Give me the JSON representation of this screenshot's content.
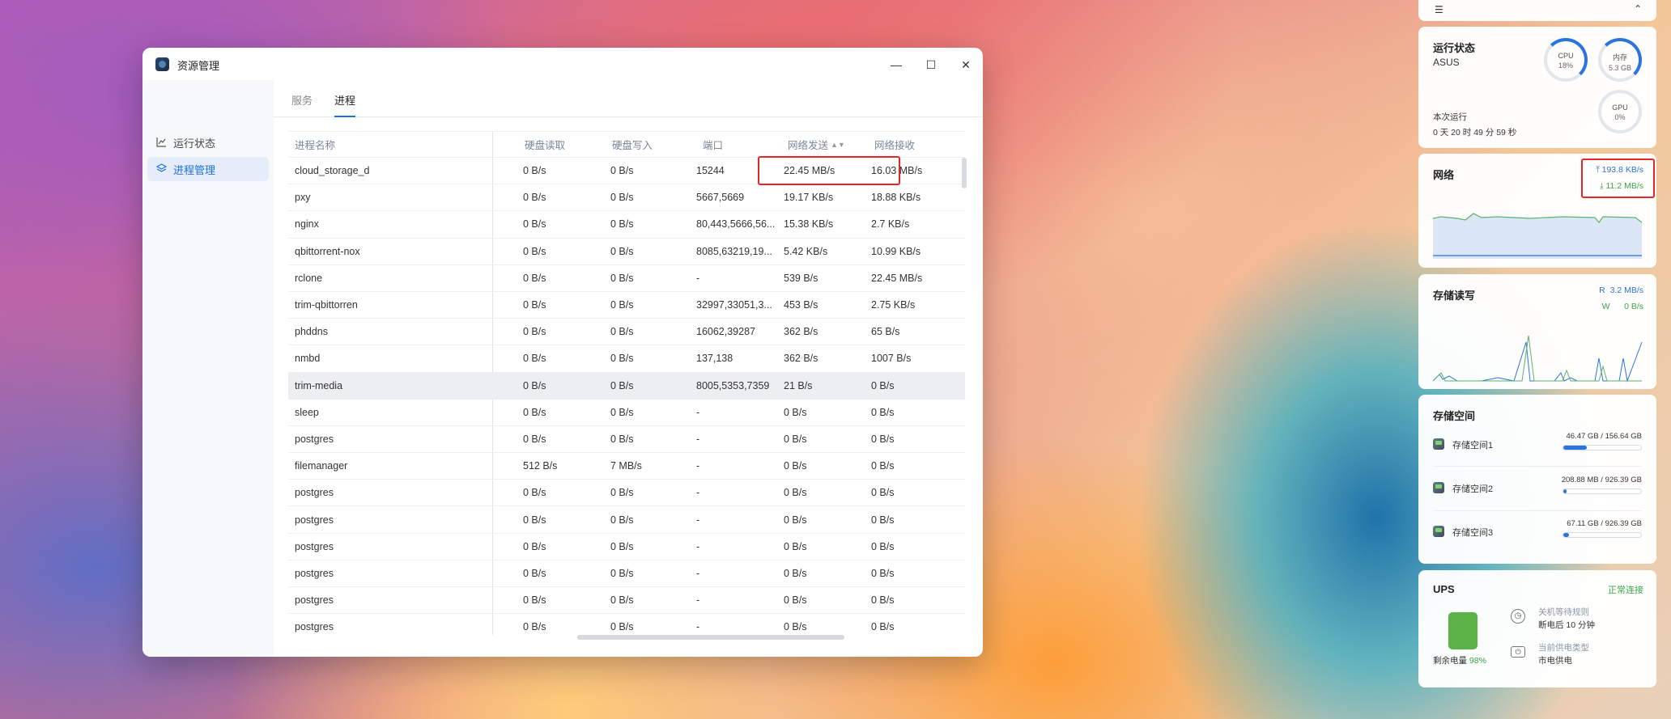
{
  "window": {
    "title": "资源管理",
    "controls": {
      "minimize": "—",
      "maximize": "☐",
      "close": "✕"
    }
  },
  "sidebar": {
    "items": [
      {
        "label": "运行状态",
        "icon": "line-chart-icon",
        "active": false
      },
      {
        "label": "进程管理",
        "icon": "layers-icon",
        "active": true
      }
    ]
  },
  "tabs": [
    {
      "label": "服务",
      "active": false
    },
    {
      "label": "进程",
      "active": true
    }
  ],
  "table": {
    "headers": [
      "进程名称",
      "硬盘读取",
      "硬盘写入",
      "端口",
      "网络发送",
      "网络接收"
    ],
    "sort_column": "网络发送",
    "rows": [
      [
        "cloud_storage_d",
        "0 B/s",
        "0 B/s",
        "15244",
        "22.45 MB/s",
        "16.03 MB/s"
      ],
      [
        "pxy",
        "0 B/s",
        "0 B/s",
        "5667,5669",
        "19.17 KB/s",
        "18.88 KB/s"
      ],
      [
        "nginx",
        "0 B/s",
        "0 B/s",
        "80,443,5666,56...",
        "15.38 KB/s",
        "2.7 KB/s"
      ],
      [
        "qbittorrent-nox",
        "0 B/s",
        "0 B/s",
        "8085,63219,19...",
        "5.42 KB/s",
        "10.99 KB/s"
      ],
      [
        "rclone",
        "0 B/s",
        "0 B/s",
        "-",
        "539 B/s",
        "22.45 MB/s"
      ],
      [
        "trim-qbittorren",
        "0 B/s",
        "0 B/s",
        "32997,33051,3...",
        "453 B/s",
        "2.75 KB/s"
      ],
      [
        "phddns",
        "0 B/s",
        "0 B/s",
        "16062,39287",
        "362 B/s",
        "65 B/s"
      ],
      [
        "nmbd",
        "0 B/s",
        "0 B/s",
        "137,138",
        "362 B/s",
        "1007 B/s"
      ],
      [
        "trim-media",
        "0 B/s",
        "0 B/s",
        "8005,5353,7359",
        "21 B/s",
        "0 B/s"
      ],
      [
        "sleep",
        "0 B/s",
        "0 B/s",
        "-",
        "0 B/s",
        "0 B/s"
      ],
      [
        "postgres",
        "0 B/s",
        "0 B/s",
        "-",
        "0 B/s",
        "0 B/s"
      ],
      [
        "filemanager",
        "512 B/s",
        "7 MB/s",
        "-",
        "0 B/s",
        "0 B/s"
      ],
      [
        "postgres",
        "0 B/s",
        "0 B/s",
        "-",
        "0 B/s",
        "0 B/s"
      ],
      [
        "postgres",
        "0 B/s",
        "0 B/s",
        "-",
        "0 B/s",
        "0 B/s"
      ],
      [
        "postgres",
        "0 B/s",
        "0 B/s",
        "-",
        "0 B/s",
        "0 B/s"
      ],
      [
        "postgres",
        "0 B/s",
        "0 B/s",
        "-",
        "0 B/s",
        "0 B/s"
      ],
      [
        "postgres",
        "0 B/s",
        "0 B/s",
        "-",
        "0 B/s",
        "0 B/s"
      ],
      [
        "postgres",
        "0 B/s",
        "0 B/s",
        "-",
        "0 B/s",
        "0 B/s"
      ]
    ],
    "highlighted_row": 8
  },
  "widgets": {
    "status": {
      "title": "运行状态",
      "device": "ASUS",
      "cpu_label": "CPU",
      "cpu_value": "18%",
      "cpu_percent": 18,
      "mem_label": "内存",
      "mem_value": "5.3 GB",
      "mem_percent": 40,
      "gpu_label": "GPU",
      "gpu_value": "0%",
      "uptime_label": "本次运行",
      "uptime_value": "0 天 20 时 49 分 59 秒"
    },
    "network": {
      "title": "网络",
      "upload": "193.8 KB/s",
      "download": "11.2 MB/s"
    },
    "disk_io": {
      "title": "存储读写",
      "read_label": "R",
      "read": "3.2 MB/s",
      "write_label": "W",
      "write": "0 B/s"
    },
    "storage": {
      "title": "存储空间",
      "items": [
        {
          "name": "存储空间1",
          "used": "46.47 GB / 156.64 GB",
          "fraction": 0.297
        },
        {
          "name": "存储空间2",
          "used": "208.88 MB / 926.39 GB",
          "fraction": 0.0002
        },
        {
          "name": "存储空间3",
          "used": "67.11 GB / 926.39 GB",
          "fraction": 0.072
        }
      ]
    },
    "ups": {
      "title": "UPS",
      "status": "正常连接",
      "battery_label": "剩余电量",
      "battery_value": "98%",
      "shutdown_label": "关机等待规则",
      "shutdown_value": "断电后 10 分钟",
      "power_label": "当前供电类型",
      "power_value": "市电供电"
    }
  },
  "colors": {
    "accent": "#1f6fe5",
    "highlight_box": "#e5252a",
    "green": "#3ba54a"
  }
}
